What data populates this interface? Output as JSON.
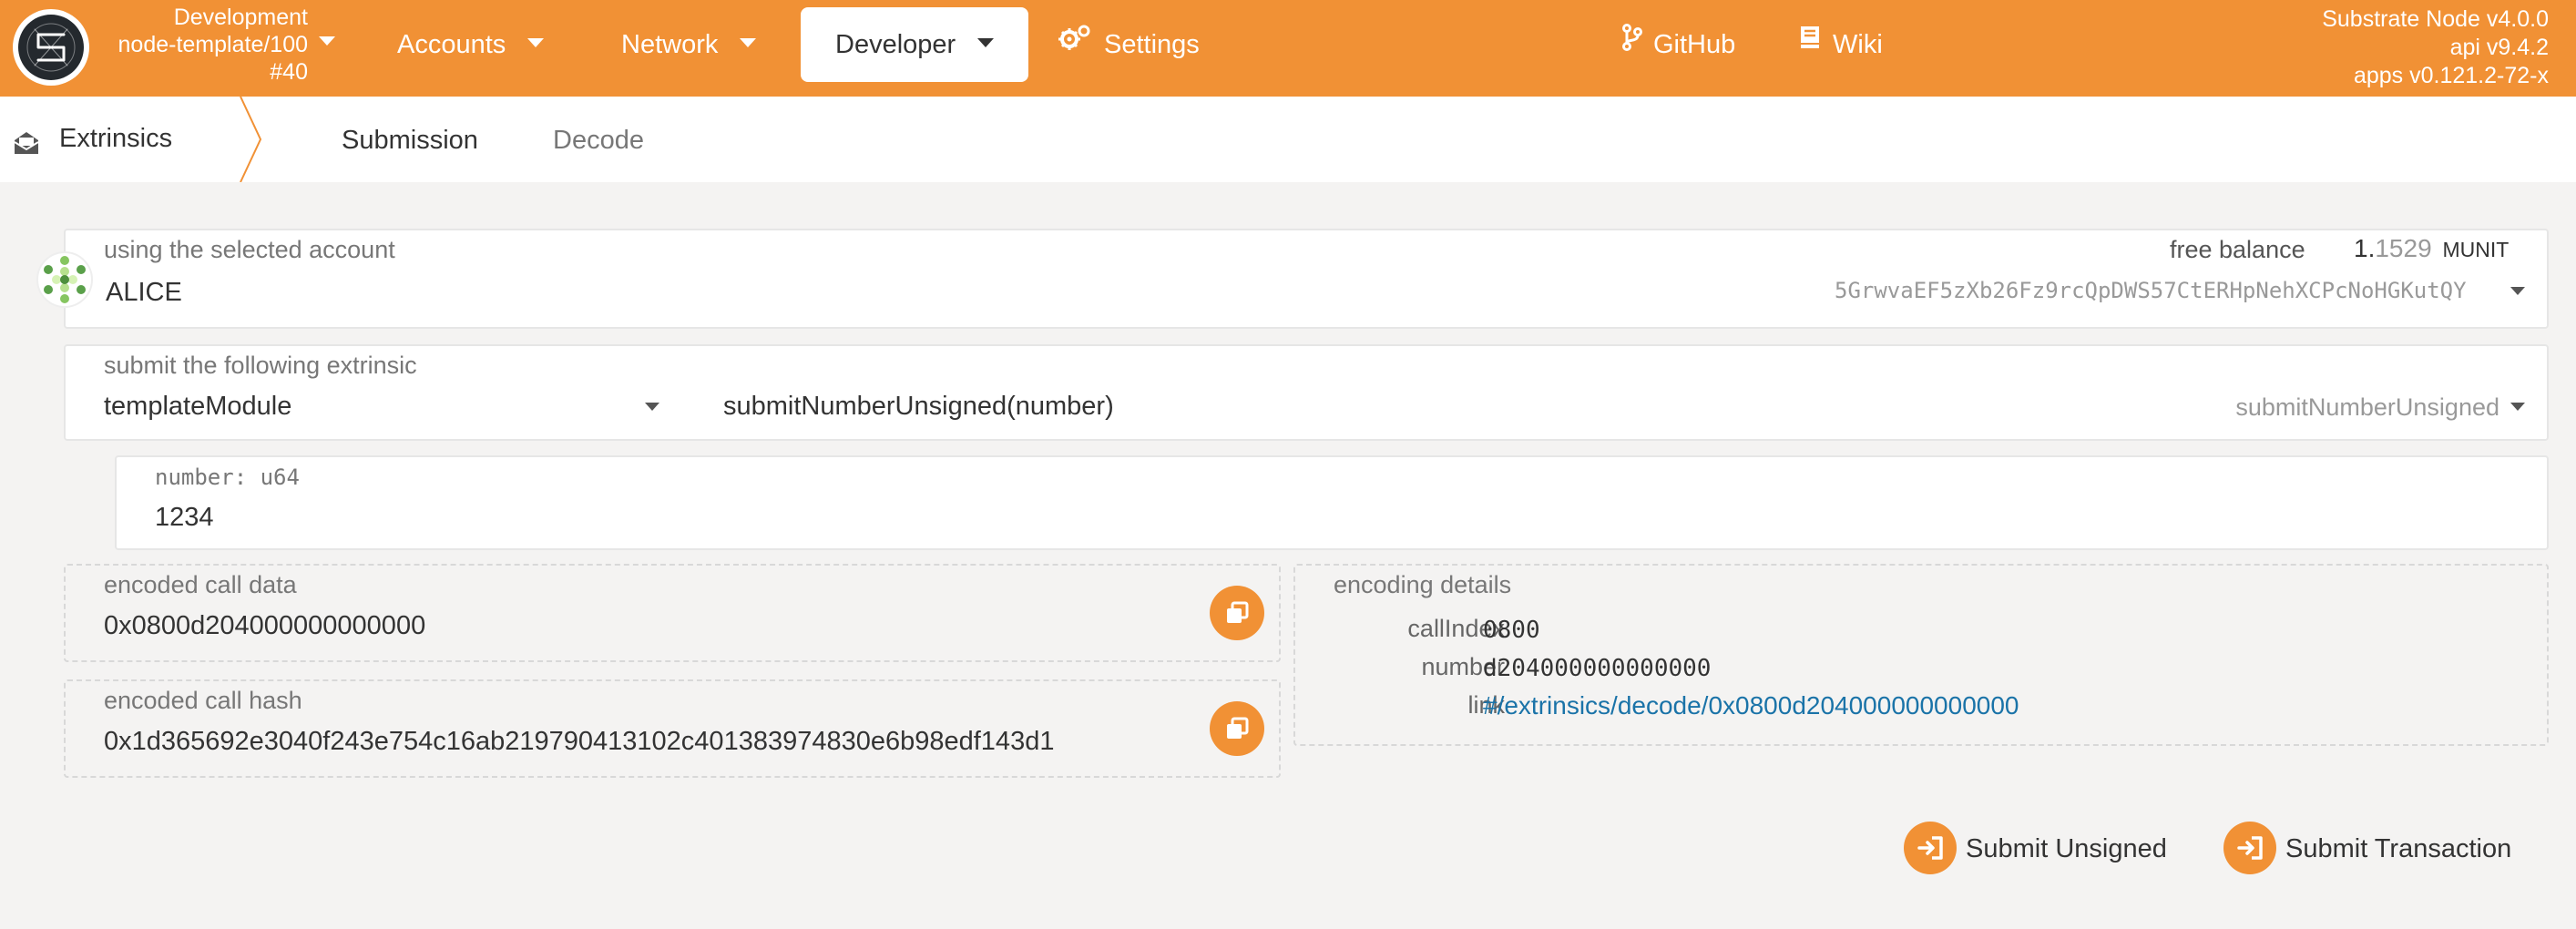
{
  "chain": {
    "name": "Development",
    "runtime": "node-template/100",
    "block": "#40"
  },
  "nav": {
    "accounts": "Accounts",
    "network": "Network",
    "developer": "Developer",
    "settings": "Settings",
    "github": "GitHub",
    "wiki": "Wiki"
  },
  "node_info": {
    "node": "Substrate Node v4.0.0",
    "api": "api v9.4.2",
    "apps": "apps v0.121.2-72-x"
  },
  "subnav": {
    "section": "Extrinsics",
    "tabs": [
      "Submission",
      "Decode"
    ]
  },
  "account": {
    "label": "using the selected account",
    "name": "ALICE",
    "balance_label": "free balance",
    "balance_int": "1.",
    "balance_frac": "1529",
    "balance_unit": "MUNIT",
    "address": "5GrwvaEF5zXb26Fz9rcQpDWS57CtERHpNehXCPcNoHGKutQY"
  },
  "extrinsic": {
    "label": "submit the following extrinsic",
    "module": "templateModule",
    "call_signature": "submitNumberUnsigned(number)",
    "call_name": "submitNumberUnsigned"
  },
  "param": {
    "label": "number: u64",
    "value": "1234"
  },
  "encoded_call_data": {
    "label": "encoded call data",
    "value": "0x0800d204000000000000"
  },
  "encoded_call_hash": {
    "label": "encoded call hash",
    "value": "0x1d365692e3040f243e754c16ab219790413102c401383974830e6b98edf143d1"
  },
  "encoding_details": {
    "label": "encoding details",
    "call_index_key": "callIndex",
    "call_index_value": "0800",
    "number_key": "number",
    "number_value": "d204000000000000",
    "link_key": "link",
    "link_value": "#/extrinsics/decode/0x0800d204000000000000"
  },
  "actions": {
    "submit_unsigned": "Submit Unsigned",
    "submit_transaction": "Submit Transaction"
  },
  "colors": {
    "brand": "#f19135",
    "link": "#1a73a8",
    "background": "#f4f3f2"
  }
}
